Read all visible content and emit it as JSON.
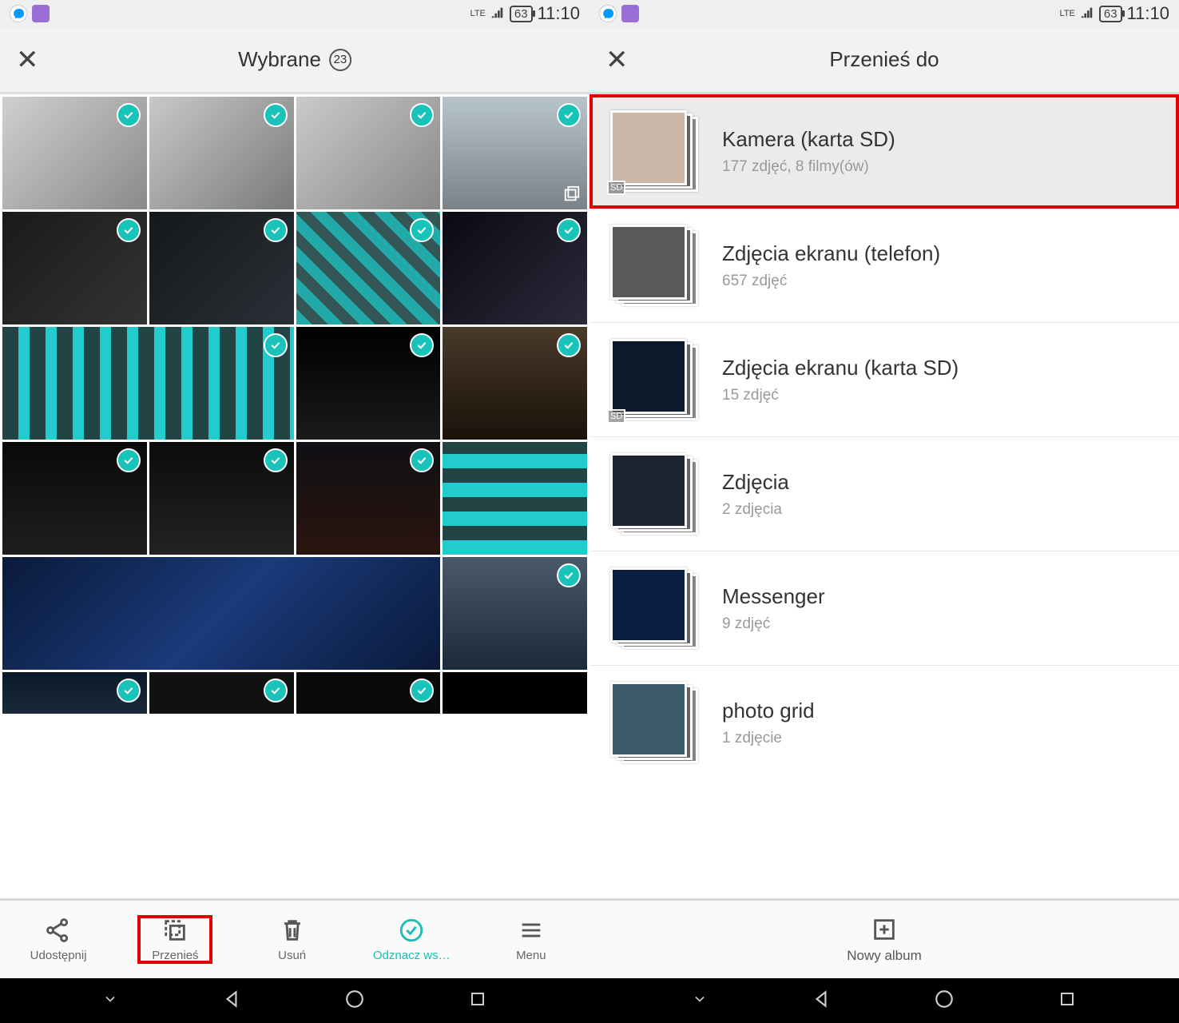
{
  "status": {
    "network": "LTE",
    "battery": "63",
    "time": "11:10"
  },
  "left": {
    "header_title": "Wybrane",
    "selected_count": "23",
    "actions": {
      "share": "Udostępnij",
      "move": "Przenieś",
      "delete": "Usuń",
      "deselect": "Odznacz ws…",
      "menu": "Menu"
    }
  },
  "right": {
    "header_title": "Przenieś do",
    "albums": [
      {
        "title": "Kamera (karta SD)",
        "sub": "177 zdjęć,  8 filmy(ów)",
        "sd": true,
        "highlight": true,
        "color": "#cbb8a8"
      },
      {
        "title": "Zdjęcia ekranu (telefon)",
        "sub": "657 zdjęć",
        "sd": false,
        "highlight": false,
        "color": "#5a5a5a"
      },
      {
        "title": "Zdjęcia ekranu (karta SD)",
        "sub": "15 zdjęć",
        "sd": true,
        "highlight": false,
        "color": "#0a1a2b"
      },
      {
        "title": "Zdjęcia",
        "sub": "2 zdjęcia",
        "sd": false,
        "highlight": false,
        "color": "#1c2530"
      },
      {
        "title": "Messenger",
        "sub": "9 zdjęć",
        "sd": false,
        "highlight": false,
        "color": "#0a1e40"
      },
      {
        "title": "photo grid",
        "sub": "1 zdjęcie",
        "sd": false,
        "highlight": false,
        "color": "#3c5c6e"
      }
    ],
    "new_album": "Nowy album"
  },
  "thumbs": [
    {
      "bg": "linear-gradient(135deg,#d0d0d0,#8a8a8a)",
      "check": true,
      "burst": false
    },
    {
      "bg": "linear-gradient(135deg,#c8c8c8,#7a7a7a)",
      "check": true,
      "burst": false
    },
    {
      "bg": "linear-gradient(135deg,#cacaca,#888)",
      "check": true,
      "burst": false
    },
    {
      "bg": "linear-gradient(180deg,#b8c4cc,#7a8288)",
      "check": true,
      "burst": true
    },
    {
      "bg": "linear-gradient(135deg,#1a1a1a,#333)",
      "check": true,
      "burst": false
    },
    {
      "bg": "linear-gradient(135deg,#14181c,#2a3036)",
      "check": true,
      "burst": false
    },
    {
      "bg": "repeating-linear-gradient(45deg,#2aa,#2aa 14px,#355 14px,#355 28px)",
      "check": true,
      "burst": false
    },
    {
      "bg": "linear-gradient(135deg,#0a0a14,#2a2a3a)",
      "check": true,
      "burst": false
    },
    {
      "bg": "repeating-linear-gradient(90deg,#244,#244 20px,#2cc 20px,#2cc 34px)",
      "check": true,
      "span": 2
    },
    {
      "bg": "linear-gradient(180deg,#000,#1a1a1a)",
      "check": true,
      "burst": false
    },
    {
      "bg": "linear-gradient(180deg,#4a3a2a,#1a120a)",
      "check": true,
      "burst": false
    },
    {
      "bg": "linear-gradient(180deg,#0a0a0a,#1e1e1e)",
      "check": true,
      "burst": false
    },
    {
      "bg": "linear-gradient(180deg,#0c0c0c,#222)",
      "check": true,
      "burst": false
    },
    {
      "bg": "linear-gradient(180deg,#101014,#2a1410)",
      "check": true,
      "burst": false
    },
    {
      "bg": "repeating-linear-gradient(0deg,#2cc,#2cc 18px,#244 18px,#244 36px)",
      "check": false,
      "burst": false
    },
    {
      "bg": "linear-gradient(135deg,#0a1a3a,#1a3a7a,#0a1a3a)",
      "check": false,
      "span": 3
    },
    {
      "bg": "linear-gradient(180deg,#4a5a6a,#1a2a3a)",
      "check": true
    },
    {
      "bg": "linear-gradient(180deg,#0a1a2a,#1a2a3a)",
      "check": true,
      "short": true
    },
    {
      "bg": "#111",
      "check": true,
      "short": true
    },
    {
      "bg": "#0a0a0a",
      "check": true,
      "short": true
    },
    {
      "bg": "#000",
      "check": false,
      "short": true
    }
  ]
}
